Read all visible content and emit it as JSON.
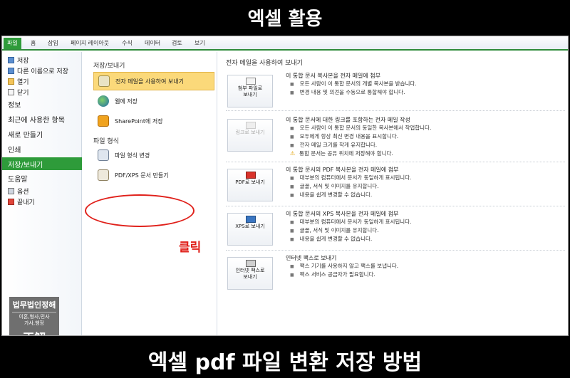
{
  "frame": {
    "title": "엑셀 활용",
    "caption": "엑셀 pdf 파일 변환 저장 방법"
  },
  "ribbon": {
    "tabs": [
      "파일",
      "홈",
      "삽입",
      "페이지 레이아웃",
      "수식",
      "데이터",
      "검토",
      "보기"
    ]
  },
  "nav": {
    "items": [
      "저장",
      "다른 이름으로 저장",
      "열기",
      "닫기",
      "정보",
      "최근에 사용한 항목",
      "새로 만들기",
      "인쇄",
      "저장/보내기",
      "도움말",
      "옵션",
      "끝내기"
    ]
  },
  "stamp": {
    "title": "법무법인정해",
    "line1": "이혼,형사,민사",
    "line2": "가사,행정",
    "mark": "正解"
  },
  "mid": {
    "heading": "저장/보내기",
    "items": [
      "전자 메일을 사용하여 보내기",
      "웹에 저장",
      "SharePoint에 저장"
    ],
    "heading2": "파일 형식",
    "items2": [
      "파일 형식 변경",
      "PDF/XPS 문서 만들기"
    ],
    "click_label": "클릭"
  },
  "detail": {
    "heading": "전자 메일을 사용하여 보내기",
    "sections": [
      {
        "button": "첨부 파일로\n보내기",
        "title": "이 통합 문서 복사본을 전자 메일에 첨부",
        "bullets": [
          "모든 사람이 이 통합 문서의 개별 복사본을 받습니다.",
          "변경 내용 및 의견을 수동으로 통합해야 합니다."
        ]
      },
      {
        "button": "링크로 보내기",
        "title": "이 통합 문서에 대한 링크를 포함하는 전자 메일 작성",
        "bullets": [
          "모든 사람이 이 통합 문서의 동일한 복사본에서 작업합니다.",
          "모두에게 항상 최신 변경 내용을 표시합니다.",
          "전자 메일 크기를 작게 유지합니다.",
          "통합 문서는 공유 위치에 저장해야 합니다."
        ]
      },
      {
        "button": "PDF로 보내기",
        "title": "이 통합 문서의 PDF 복사본을 전자 메일에 첨부",
        "bullets": [
          "대부분의 컴퓨터에서 문서가 동일하게 표시됩니다.",
          "글꼴, 서식 및 이미지를 유지합니다.",
          "내용을 쉽게 변경할 수 없습니다."
        ]
      },
      {
        "button": "XPS로 보내기",
        "title": "이 통합 문서의 XPS 복사본을 전자 메일에 첨부",
        "bullets": [
          "대부분의 컴퓨터에서 문서가 동일하게 표시됩니다.",
          "글꼴, 서식 및 이미지를 유지합니다.",
          "내용을 쉽게 변경할 수 없습니다."
        ]
      },
      {
        "button": "인터넷 팩스로\n보내기",
        "title": "인터넷 팩스로 보내기",
        "bullets": [
          "팩스 기기를 사용하지 않고 팩스를 보냅니다.",
          "팩스 서비스 공급자가 필요합니다."
        ]
      }
    ]
  }
}
